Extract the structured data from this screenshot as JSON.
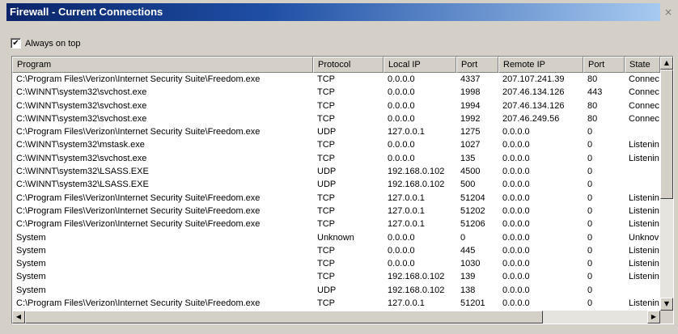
{
  "window": {
    "title": "Firewall - Current Connections",
    "close_glyph": "×"
  },
  "always_on_top": {
    "label": "Always on top",
    "checked": true,
    "check_glyph": "✔"
  },
  "columns": [
    "Program",
    "Protocol",
    "Local IP",
    "Port",
    "Remote IP",
    "Port",
    "State"
  ],
  "rows": [
    [
      "C:\\Program Files\\Verizon\\Internet Security Suite\\Freedom.exe",
      "TCP",
      "0.0.0.0",
      "4337",
      "207.107.241.39",
      "80",
      "Connec"
    ],
    [
      "C:\\WINNT\\system32\\svchost.exe",
      "TCP",
      "0.0.0.0",
      "1998",
      "207.46.134.126",
      "443",
      "Connec"
    ],
    [
      "C:\\WINNT\\system32\\svchost.exe",
      "TCP",
      "0.0.0.0",
      "1994",
      "207.46.134.126",
      "80",
      "Connec"
    ],
    [
      "C:\\WINNT\\system32\\svchost.exe",
      "TCP",
      "0.0.0.0",
      "1992",
      "207.46.249.56",
      "80",
      "Connec"
    ],
    [
      "C:\\Program Files\\Verizon\\Internet Security Suite\\Freedom.exe",
      "UDP",
      "127.0.0.1",
      "1275",
      "0.0.0.0",
      "0",
      ""
    ],
    [
      "C:\\WINNT\\system32\\mstask.exe",
      "TCP",
      "0.0.0.0",
      "1027",
      "0.0.0.0",
      "0",
      "Listenin"
    ],
    [
      "C:\\WINNT\\system32\\svchost.exe",
      "TCP",
      "0.0.0.0",
      "135",
      "0.0.0.0",
      "0",
      "Listenin"
    ],
    [
      "C:\\WINNT\\system32\\LSASS.EXE",
      "UDP",
      "192.168.0.102",
      "4500",
      "0.0.0.0",
      "0",
      ""
    ],
    [
      "C:\\WINNT\\system32\\LSASS.EXE",
      "UDP",
      "192.168.0.102",
      "500",
      "0.0.0.0",
      "0",
      ""
    ],
    [
      "C:\\Program Files\\Verizon\\Internet Security Suite\\Freedom.exe",
      "TCP",
      "127.0.0.1",
      "51204",
      "0.0.0.0",
      "0",
      "Listenin"
    ],
    [
      "C:\\Program Files\\Verizon\\Internet Security Suite\\Freedom.exe",
      "TCP",
      "127.0.0.1",
      "51202",
      "0.0.0.0",
      "0",
      "Listenin"
    ],
    [
      "C:\\Program Files\\Verizon\\Internet Security Suite\\Freedom.exe",
      "TCP",
      "127.0.0.1",
      "51206",
      "0.0.0.0",
      "0",
      "Listenin"
    ],
    [
      "System",
      "Unknown",
      "0.0.0.0",
      "0",
      "0.0.0.0",
      "0",
      "Unknov"
    ],
    [
      "System",
      "TCP",
      "0.0.0.0",
      "445",
      "0.0.0.0",
      "0",
      "Listenin"
    ],
    [
      "System",
      "TCP",
      "0.0.0.0",
      "1030",
      "0.0.0.0",
      "0",
      "Listenin"
    ],
    [
      "System",
      "TCP",
      "192.168.0.102",
      "139",
      "0.0.0.0",
      "0",
      "Listenin"
    ],
    [
      "System",
      "UDP",
      "192.168.0.102",
      "138",
      "0.0.0.0",
      "0",
      ""
    ],
    [
      "C:\\Program Files\\Verizon\\Internet Security Suite\\Freedom.exe",
      "TCP",
      "127.0.0.1",
      "51201",
      "0.0.0.0",
      "0",
      "Listenin"
    ]
  ],
  "scroll_icons": {
    "up": "▲",
    "down": "▼",
    "left": "◀",
    "right": "▶"
  }
}
